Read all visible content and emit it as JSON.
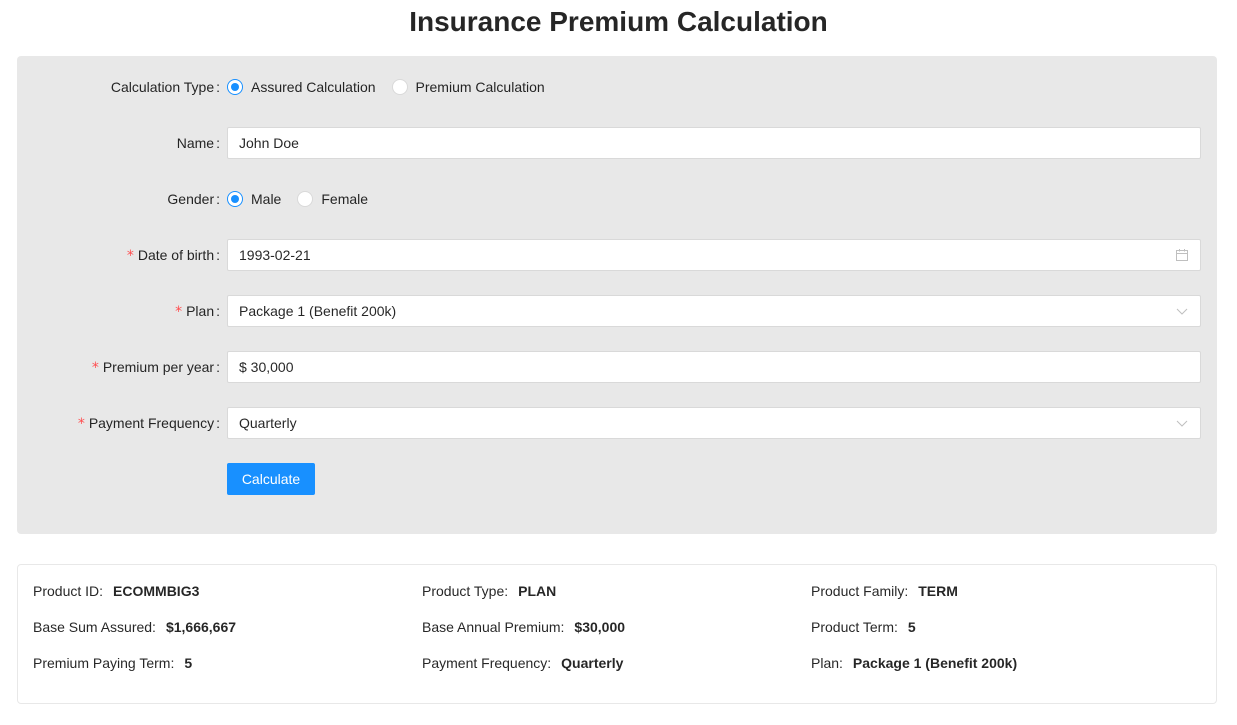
{
  "title": "Insurance Premium Calculation",
  "form": {
    "calculation_type": {
      "label": "Calculation Type",
      "options": [
        "Assured Calculation",
        "Premium Calculation"
      ],
      "selected": "Assured Calculation"
    },
    "name": {
      "label": "Name",
      "value": "John Doe"
    },
    "gender": {
      "label": "Gender",
      "options": [
        "Male",
        "Female"
      ],
      "selected": "Male"
    },
    "dob": {
      "label": "Date of birth",
      "required": true,
      "value": "1993-02-21",
      "icon": "calendar-icon"
    },
    "plan": {
      "label": "Plan",
      "required": true,
      "value": "Package 1 (Benefit 200k)",
      "icon": "chevron-down-icon"
    },
    "premium": {
      "label": "Premium per year",
      "required": true,
      "value": "$ 30,000"
    },
    "payment_frequency": {
      "label": "Payment Frequency",
      "required": true,
      "value": "Quarterly",
      "icon": "chevron-down-icon"
    },
    "calculate_label": "Calculate"
  },
  "summary": {
    "product_id": {
      "label": "Product ID:",
      "value": "ECOMMBIG3"
    },
    "product_type": {
      "label": "Product Type:",
      "value": "PLAN"
    },
    "product_family": {
      "label": "Product Family:",
      "value": "TERM"
    },
    "base_sum_assured": {
      "label": "Base Sum Assured:",
      "value": "$1,666,667"
    },
    "base_annual_premium": {
      "label": "Base Annual Premium:",
      "value": "$30,000"
    },
    "product_term": {
      "label": "Product Term:",
      "value": "5"
    },
    "premium_paying_term": {
      "label": "Premium Paying Term:",
      "value": "5"
    },
    "payment_frequency": {
      "label": "Payment Frequency:",
      "value": "Quarterly"
    },
    "plan": {
      "label": "Plan:",
      "value": "Package 1 (Benefit 200k)"
    }
  },
  "colors": {
    "primary": "#1890ff",
    "required": "#ff4d4f",
    "panel_bg": "#e8e8e8"
  }
}
